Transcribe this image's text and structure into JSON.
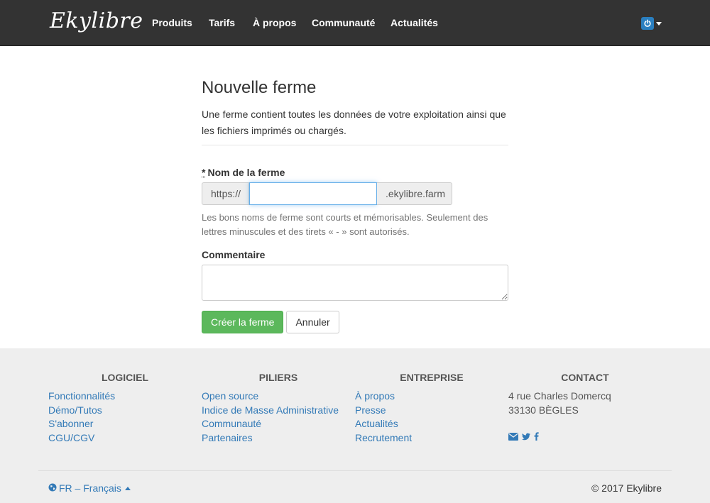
{
  "brand": "Ekylibre",
  "nav": {
    "items": [
      {
        "label": "Produits"
      },
      {
        "label": "Tarifs"
      },
      {
        "label": "À propos"
      },
      {
        "label": "Communauté"
      },
      {
        "label": "Actualités"
      }
    ],
    "user_menu_icon": "power-icon"
  },
  "form": {
    "title": "Nouvelle ferme",
    "description": "Une ferme contient toutes les données de votre exploitation ainsi que les fichiers imprimés ou chargés.",
    "farm_name": {
      "required_marker": "*",
      "label": "Nom de la ferme",
      "prefix": "https://",
      "value": "",
      "suffix": ".ekylibre.farm",
      "help": "Les bons noms de ferme sont courts et mémorisables. Seulement des lettres minuscules et des tirets « - » sont autorisés."
    },
    "comment": {
      "label": "Commentaire",
      "value": ""
    },
    "submit_label": "Créer la ferme",
    "cancel_label": "Annuler"
  },
  "footer": {
    "columns": [
      {
        "title": "LOGICIEL",
        "links": [
          "Fonctionnalités",
          "Démo/Tutos",
          "S'abonner",
          "CGU/CGV"
        ]
      },
      {
        "title": "PILIERS",
        "links": [
          "Open source",
          "Indice de Masse Administrative",
          "Communauté",
          "Partenaires"
        ]
      },
      {
        "title": "ENTREPRISE",
        "links": [
          "À propos",
          "Presse",
          "Actualités",
          "Recrutement"
        ]
      }
    ],
    "contact": {
      "title": "CONTACT",
      "address_line1": "4 rue Charles Domercq",
      "address_line2": "33130 BÈGLES",
      "social_icons": [
        "envelope-icon",
        "twitter-icon",
        "facebook-icon"
      ]
    },
    "language": "FR – Français",
    "copyright": "© 2017 Ekylibre"
  },
  "colors": {
    "navbar": "#333333",
    "primary": "#337ab7",
    "success": "#5cb85c",
    "footer_bg": "#eeeeee"
  }
}
